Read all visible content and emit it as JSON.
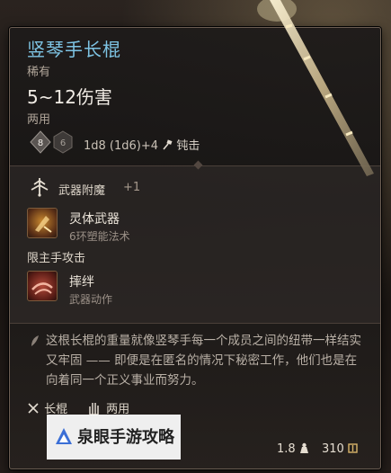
{
  "item": {
    "name": "竖琴手长棍",
    "rarity": "稀有",
    "damage": "5~12伤害",
    "handedness": "两用",
    "dice": {
      "die_a": "8",
      "die_b": "6"
    },
    "damage_formula": "1d8 (1d6)+4",
    "damage_type": "钝击"
  },
  "enchantment": {
    "label": "武器附魔",
    "value": "+1"
  },
  "actions": [
    {
      "name": "灵体武器",
      "subtitle": "6环塑能法术"
    },
    {
      "name": "摔绊",
      "subtitle": "武器动作"
    }
  ],
  "offhand_label": "限主手攻击",
  "description": "这根长棍的重量就像竖琴手每一个成员之间的纽带一样结实又牢固 —— 即便是在匿名的情况下秘密工作，他们也是在向着同一个正义事业而努力。",
  "proficiency": {
    "type": "长棍",
    "handed": "两用"
  },
  "weight": "1.8",
  "price": "310",
  "watermark": "泉眼手游攻略",
  "colors": {
    "title": "#7ec4e4",
    "border": "#6b5d52",
    "accent": "#c2a27a"
  },
  "icons": [
    "dice-d8-icon",
    "dice-d6-icon",
    "bludgeon-icon",
    "enchant-icon",
    "spiritual-weapon-icon",
    "topple-icon",
    "feather-icon",
    "staff-type-icon",
    "two-hand-icon",
    "weight-icon",
    "gold-icon",
    "watermark-logo-icon"
  ]
}
